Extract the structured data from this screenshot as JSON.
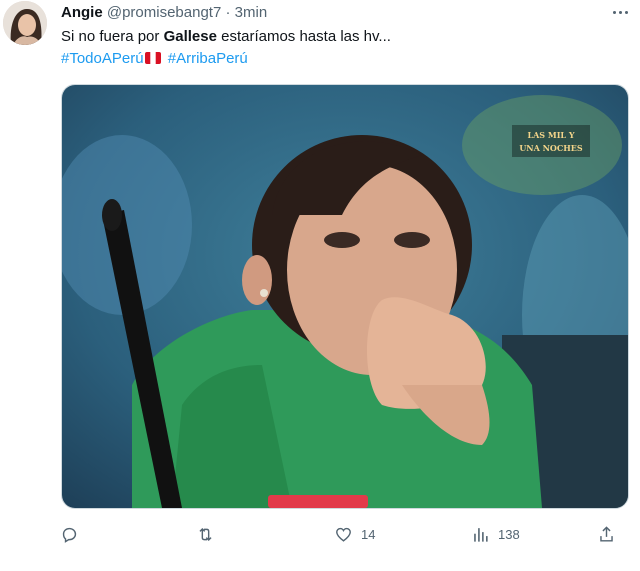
{
  "tweet": {
    "author_name": "Angie",
    "author_handle": "@promisebangt7",
    "separator": "·",
    "time": "3min",
    "text_before": "Si no fuera por ",
    "text_bold": "Gallese",
    "text_after": " estaríamos hasta las hv...",
    "hashtag_1": "#TodoAPerú",
    "hashtag_2": "#ArribaPerú"
  },
  "media": {
    "watermark_line1": "LAS MIL Y",
    "watermark_line2": "UNA NOCHES"
  },
  "actions": {
    "reply_icon": "reply-icon",
    "retweet_icon": "retweet-icon",
    "like_icon": "heart-icon",
    "like_count": "14",
    "views_icon": "analytics-icon",
    "views_count": "138",
    "share_icon": "share-icon"
  },
  "colors": {
    "link": "#1d9bf0",
    "muted": "#536471",
    "text": "#0f1419"
  }
}
